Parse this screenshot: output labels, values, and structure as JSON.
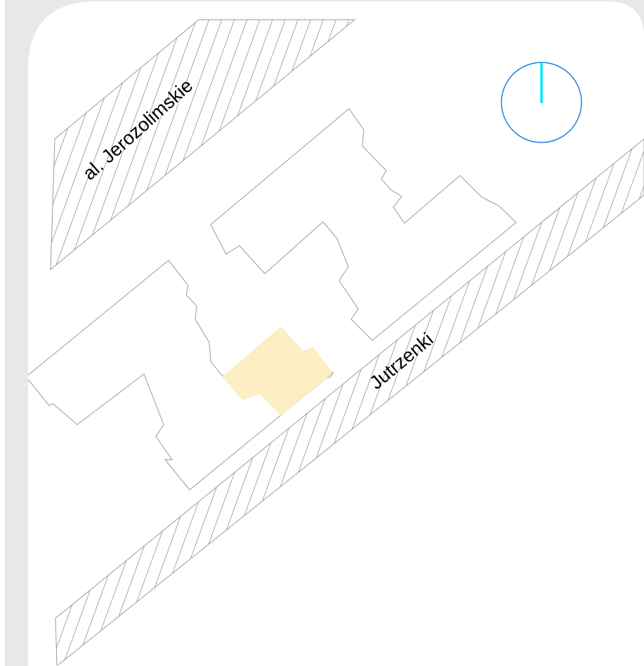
{
  "map": {
    "colors": {
      "outer_background": "#e8e8e8",
      "paper": "#ffffff",
      "outline": "#9a9a9a",
      "hatch": "#555555",
      "highlight_fill": "#fdeec4",
      "compass_circle": "#1f7fe6",
      "compass_needle": "#00e5ff"
    },
    "streets": [
      {
        "id": "jerozolimskie",
        "label": "al. Jerozolimskie"
      },
      {
        "id": "jutrzenki",
        "label": "Jutrzenki"
      }
    ],
    "buildings": [
      {
        "id": "upper-block",
        "highlighted": false
      },
      {
        "id": "lower-block",
        "highlighted": false
      },
      {
        "id": "selected-unit",
        "highlighted": true
      }
    ],
    "compass": {
      "icon": "north-arrow-icon",
      "orientation": "north-up"
    }
  }
}
